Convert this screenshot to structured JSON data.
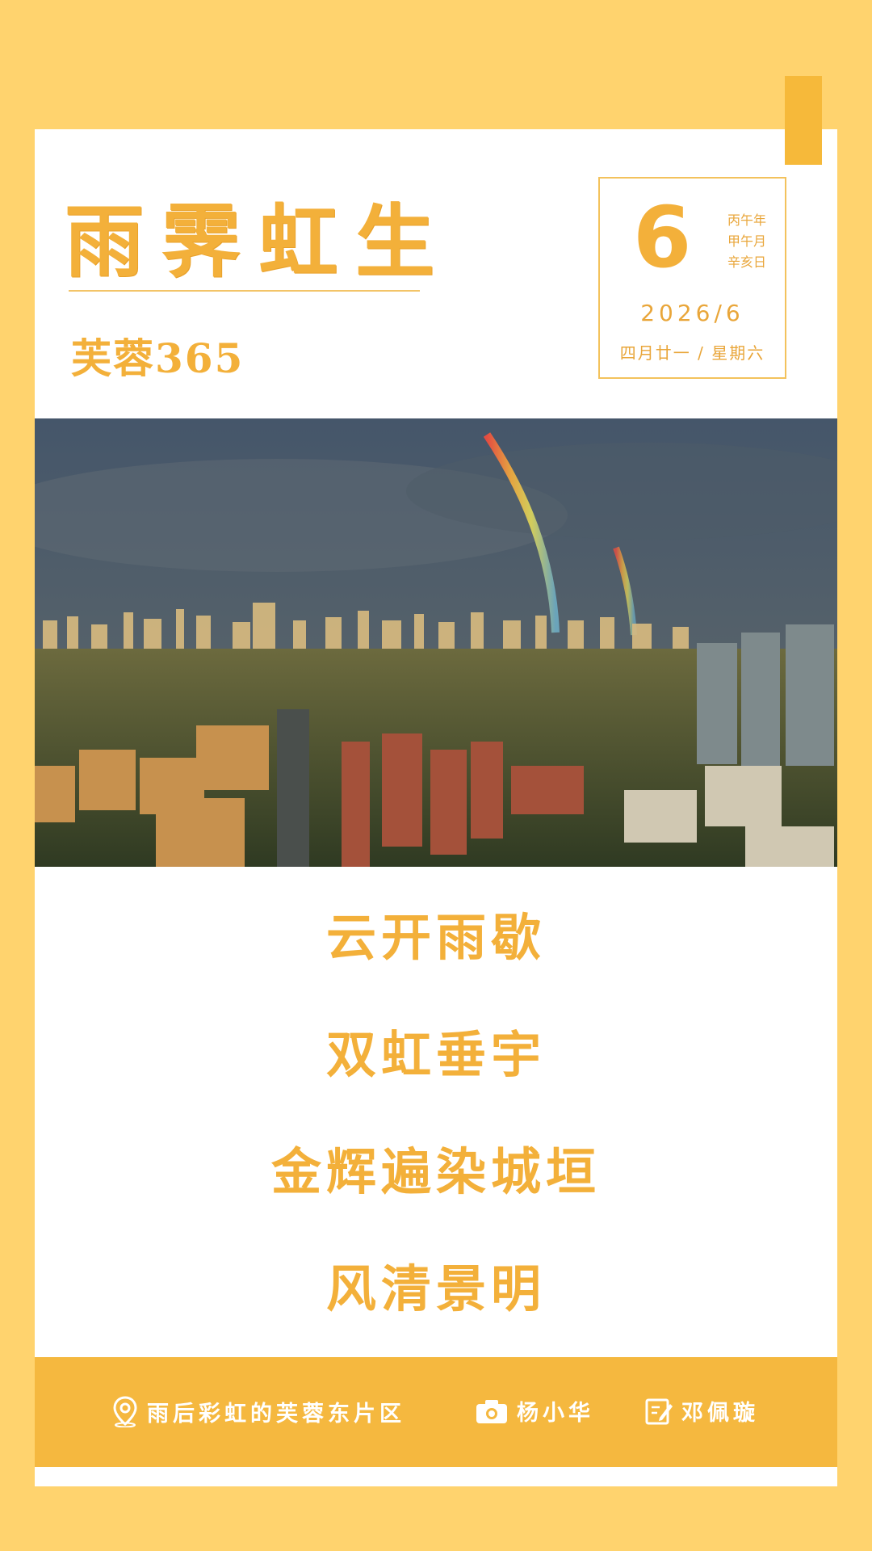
{
  "title": "雨霁虹生",
  "subtitle": "芙蓉365",
  "date": {
    "day": "6",
    "ganzhi": [
      "丙午年",
      "甲午月",
      "辛亥日"
    ],
    "year_month": "2026/6",
    "lunar_weekday": "四月廿一 / 星期六"
  },
  "poem": [
    "云开雨歇",
    "双虹垂宇",
    "金辉遍染城垣",
    "风清景明"
  ],
  "footer": {
    "location": "雨后彩虹的芙蓉东片区",
    "photographer": "杨小华",
    "editor": "邓佩璇"
  },
  "colors": {
    "background": "#ffd36e",
    "accent": "#f3b03a",
    "footer": "#f5b83f"
  }
}
